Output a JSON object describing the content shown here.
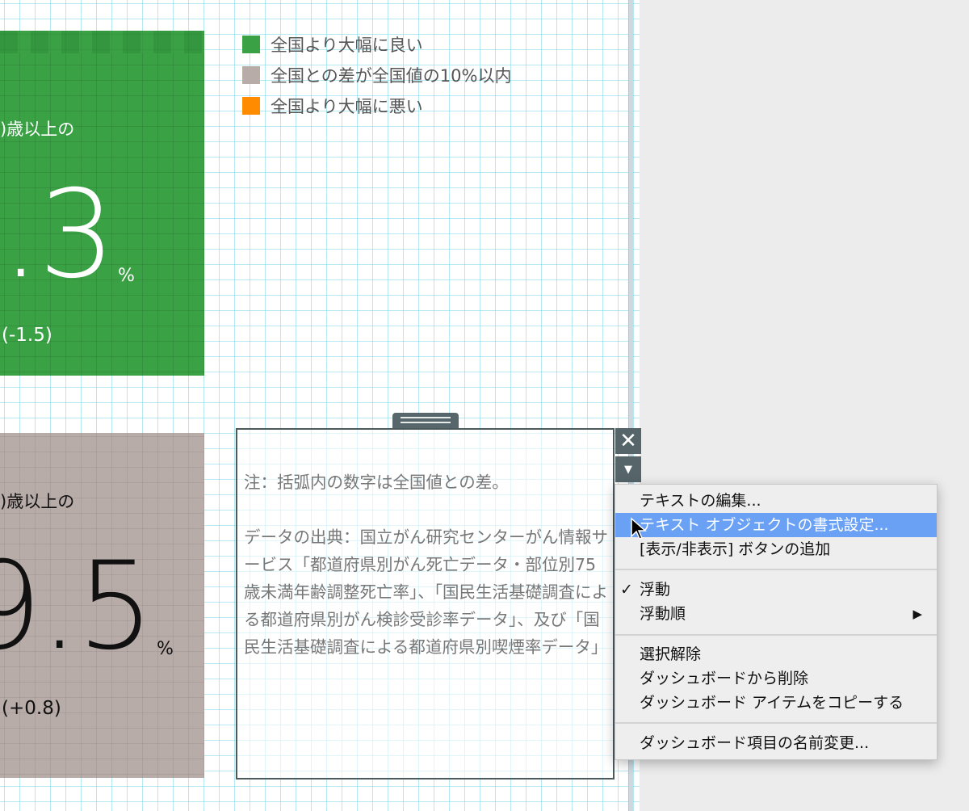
{
  "legend": [
    {
      "label": "全国より大幅に良い",
      "color": "#3aa245"
    },
    {
      "label": "全国との差が全国値の10%以内",
      "color": "#b8aca9"
    },
    {
      "label": "全国より大幅に悪い",
      "color": "#ff8c00"
    }
  ],
  "tiles": [
    {
      "label": ")歳以上の",
      "value": ".3",
      "unit": "%",
      "diff": "(-1.5)",
      "color": "#3aa245"
    },
    {
      "label": ")歳以上の",
      "value": "9.5",
      "unit": "%",
      "diff": "(+0.8)",
      "color": "#b8aca9"
    }
  ],
  "note": {
    "line1": "注：括弧内の数字は全国値との差。",
    "source": "データの出典：国立がん研究センターがん情報サービス「都道府県別がん死亡データ・部位別75歳未満年齢調整死亡率」、「国民生活基礎調査による都道府県別がん検診受診率データ」、及び「国民生活基礎調査による都道府県別喫煙率データ」"
  },
  "controls": {
    "close_icon": "close-icon",
    "dropdown_icon": "dropdown-arrow-icon"
  },
  "context_menu": {
    "items": [
      {
        "label": "テキストの編集..."
      },
      {
        "label": "テキスト オブジェクトの書式設定...",
        "highlighted": true
      },
      {
        "label": "[表示/非表示] ボタンの追加"
      },
      {
        "label": "浮動",
        "checked": true
      },
      {
        "label": "浮動順",
        "submenu": true
      },
      {
        "label": "選択解除"
      },
      {
        "label": "ダッシュボードから削除"
      },
      {
        "label": "ダッシュボード アイテムをコピーする"
      },
      {
        "label": "ダッシュボード項目の名前変更..."
      }
    ]
  }
}
